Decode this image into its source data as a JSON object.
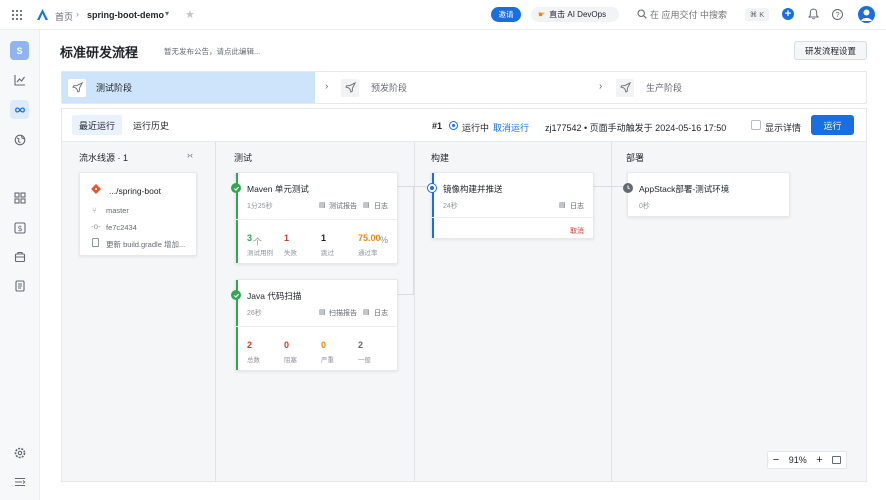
{
  "topbar": {
    "breadcrumb_home": "首页",
    "project": "spring-boot-demo",
    "invite": "邀请",
    "ai": "直击 AI DevOps",
    "search_placeholder": "在 应用交付 中搜索",
    "shortcut": "⌘ K"
  },
  "sidebar": {
    "avatar_letter": "S"
  },
  "header": {
    "title": "标准研发流程",
    "notice": "暂无发布公告，请点此编辑...",
    "settings": "研发流程设置"
  },
  "stages": [
    {
      "label": "测试阶段",
      "active": true
    },
    {
      "label": "预发阶段",
      "active": false
    },
    {
      "label": "生产阶段",
      "active": false
    }
  ],
  "run_bar": {
    "tab_recent": "最近运行",
    "tab_history": "运行历史",
    "run_no": "#1",
    "status": "运行中",
    "cancel": "取消运行",
    "trigger": "zj177542 • 页面手动触发于 2024-05-16 17:50",
    "show_detail": "显示详情",
    "run_button": "运行"
  },
  "columns": {
    "source": "流水线源 · 1",
    "test": "测试",
    "build": "构建",
    "deploy": "部署"
  },
  "source_card": {
    "repo": ".../spring-boot",
    "branch": "master",
    "commit": "fe7c2434",
    "message": "更新 build.gradle 增加..."
  },
  "jobs": {
    "maven": {
      "name": "Maven 单元测试",
      "duration": "1分25秒",
      "report": "测试报告",
      "log": "日志",
      "stats": [
        {
          "value": "3",
          "unit": "个",
          "label": "测试用例",
          "color": "#2fa84f"
        },
        {
          "value": "1",
          "unit": "",
          "label": "失败",
          "color": "#d83931"
        },
        {
          "value": "1",
          "unit": "",
          "label": "跳过",
          "color": "#1f2329"
        },
        {
          "value": "75.00",
          "unit": "%",
          "label": "通过率",
          "color": "#e8890c"
        }
      ]
    },
    "java": {
      "name": "Java 代码扫描",
      "duration": "26秒",
      "report": "扫描报告",
      "log": "日志",
      "stats": [
        {
          "value": "2",
          "unit": "",
          "label": "总数",
          "color": "#d83931"
        },
        {
          "value": "0",
          "unit": "",
          "label": "阻塞",
          "color": "#d83931"
        },
        {
          "value": "0",
          "unit": "",
          "label": "严重",
          "color": "#e8890c"
        },
        {
          "value": "2",
          "unit": "",
          "label": "一般",
          "color": "#646a73"
        }
      ]
    },
    "image": {
      "name": "镜像构建并推送",
      "duration": "24秒",
      "log": "日志",
      "cancel": "取消"
    },
    "appstack": {
      "name": "AppStack部署-测试环境",
      "duration": "0秒"
    }
  },
  "zoom": {
    "value": "91%"
  },
  "colors": {
    "primary": "#1a6fe0",
    "success": "#2fa84f",
    "danger": "#d83931",
    "warning": "#e8890c",
    "stage_active_bg": "#cde4fa"
  }
}
